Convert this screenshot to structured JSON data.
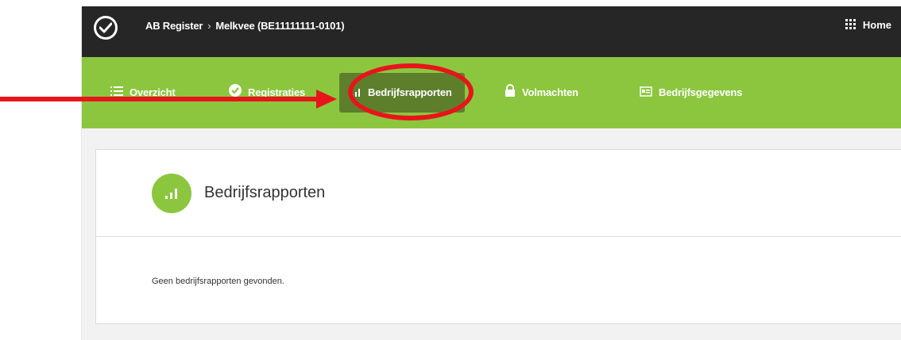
{
  "header": {
    "breadcrumb_root": "AB Register",
    "breadcrumb_separator": "›",
    "breadcrumb_current": "Melkvee (BE11111111-0101)",
    "home_label": "Home"
  },
  "nav": {
    "tabs": [
      {
        "label": "Overzicht",
        "icon": "list-icon"
      },
      {
        "label": "Registraties",
        "icon": "check-circle-icon"
      },
      {
        "label": "Bedrijfsrapporten",
        "icon": "signal-bars-icon",
        "active": true
      },
      {
        "label": "Volmachten",
        "icon": "lock-icon"
      },
      {
        "label": "Bedrijfsgegevens",
        "icon": "id-card-icon"
      }
    ]
  },
  "main": {
    "title": "Bedrijfsrapporten",
    "empty_message": "Geen bedrijfsrapporten gevonden."
  },
  "colors": {
    "topbar": "#262626",
    "nav_green": "#8cc63f",
    "active_tab": "#5d7f2c",
    "annotation_red": "#e8141b"
  }
}
